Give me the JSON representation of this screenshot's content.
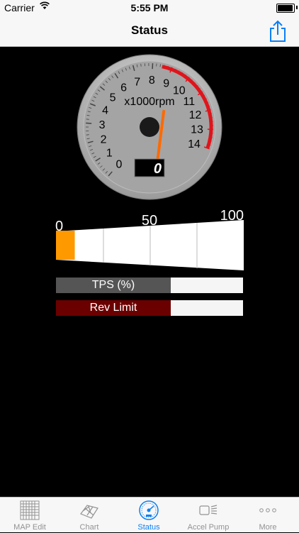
{
  "status_bar": {
    "carrier": "Carrier",
    "time": "5:55 PM"
  },
  "nav": {
    "title": "Status"
  },
  "gauge": {
    "unit_label": "x1000rpm",
    "ticks": [
      "0",
      "1",
      "2",
      "3",
      "4",
      "5",
      "6",
      "7",
      "8",
      "9",
      "10",
      "11",
      "12",
      "13",
      "14"
    ],
    "redline_from": 8.5,
    "needle_value": 10.2,
    "readout": "0"
  },
  "throttle_bar": {
    "scale_labels": [
      "0",
      "50",
      "100"
    ],
    "value_percent": 10
  },
  "tps": {
    "label": "TPS (%)",
    "bg_color": "#555555"
  },
  "rev_limit": {
    "label": "Rev Limit",
    "bg_color": "#6b0000"
  },
  "tabs": [
    {
      "label": "MAP Edit",
      "icon": "grid-icon",
      "active": false
    },
    {
      "label": "Chart",
      "icon": "surface-chart-icon",
      "active": false
    },
    {
      "label": "Status",
      "icon": "speedometer-icon",
      "active": true
    },
    {
      "label": "Accel Pump",
      "icon": "headlight-icon",
      "active": false
    },
    {
      "label": "More",
      "icon": "more-dots-icon",
      "active": false
    }
  ],
  "colors": {
    "accent": "#0a7ff5",
    "needle": "#ff6a00",
    "redline": "#e0141b",
    "throttle_fill": "#ff9900"
  }
}
